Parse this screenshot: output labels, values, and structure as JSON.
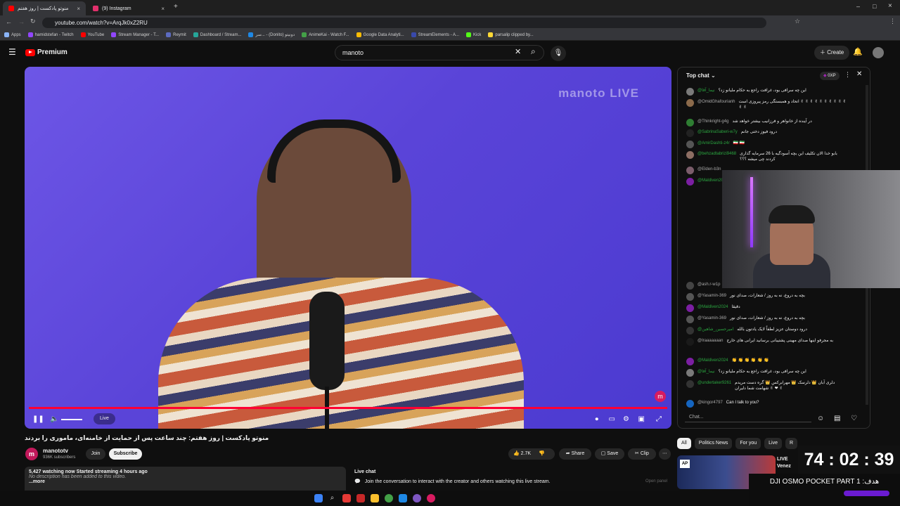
{
  "browser": {
    "tabs": [
      {
        "label": "منوتو پادکست | روز هفتم",
        "active": true
      },
      {
        "label": "(9) Instagram",
        "active": false
      }
    ],
    "url": "youtube.com/watch?v=ArqJk0xZ2RU",
    "bookmarks": [
      "Apps",
      "hamidstefan - Twitch",
      "YouTube",
      "Stream Manager - T...",
      "Reymit",
      "Dashboard / Stream...",
      "سر... - (Donito) دونیتو",
      "AnimeKai - Watch F...",
      "Google Data Analyti...",
      "StreamElements - A...",
      "Kick",
      "parsalip clipped by..."
    ]
  },
  "youtube": {
    "brand": "Premium",
    "search_value": "manoto",
    "create_label": "Create"
  },
  "video": {
    "watermark": "manoto LIVE",
    "live_label": "Live",
    "title": "منوتو پادکست | روز هفتم: چند ساعت پس از حمایت از خامنه‌ای، ماموری را بردند",
    "channel": "manototv",
    "subscribers": "936K subscribers",
    "join_label": "Join",
    "subscribe_label": "Subscribe",
    "likes": "2.7K",
    "share_label": "Share",
    "save_label": "Save",
    "clip_label": "Clip",
    "watching": "5,427 watching now  Started streaming 4 hours ago",
    "description": "No description has been added to this video.",
    "more_label": "...more",
    "livechat_title": "Live chat",
    "livechat_note": "Join the conversation to interact with the creator and others watching this live stream.",
    "open_panel_label": "Open panel"
  },
  "chat": {
    "mode": "Top chat",
    "points": "0XP",
    "input_placeholder": "Chat...",
    "messages": [
      {
        "author": "@نیما_آقا",
        "text": "این چه سرافی بود، غرافت راجع به حکام ملیانو زد؟",
        "color": "#7a7a7a"
      },
      {
        "author": "@OmidGhafourianh",
        "text": "اتحاد و همبستگی رمز پیروزی است ✌ ✌ ✌ ✌ ✌ ✌ ✌ ✌ ✌ ✌ ✌ ✌",
        "color": "#8b6a4b"
      },
      {
        "author": "@Thinkright-g4g",
        "text": "در آینده از خانواهر و فرزانیب بیشتر خواهد شد",
        "color": "#2e7d32"
      },
      {
        "author": "@SabrinaSaberi-w7y",
        "text": "درود فیوز دختی جانم",
        "color": "#222222"
      },
      {
        "author": "@AmirDashti-z4r",
        "text": "🇮🇷 🇮🇷",
        "color": "#555555"
      },
      {
        "author": "@behzadtabrizi9468",
        "text": "بابو خدا الان تکلیف این بچه آسودگیه با 26 سرمایه گذاری کردند چی میشه ؟؟؟",
        "color": "#8d6e63"
      },
      {
        "author": "@Elden-b3n",
        "text": "",
        "color": "#7b5d6b"
      },
      {
        "author": "@Maldiven2024",
        "text": "",
        "color": "#7b1fa2"
      },
      {
        "author": "@ash.r-w1p",
        "text": "",
        "color": "#444444"
      },
      {
        "author": "@Yasamin-369",
        "text": "بچه به دروغ، نه به روز / شعارات، صدای نور",
        "color": "#555555"
      },
      {
        "author": "@Maldiven2024",
        "text": "دقیقا",
        "color": "#7b1fa2"
      },
      {
        "author": "@Yasamin-369",
        "text": "بچه به دروغ، نه به روز / شعارات، صدای نور",
        "color": "#555555"
      },
      {
        "author": "@امیرحسین_شاهین",
        "text": "درود دوستان عزیز لطفاً لایک یادتون بالله",
        "color": "#333333"
      },
      {
        "author": "@Iraaaaaaan",
        "text": "به مجرفو اینها صدای مهبنی پشتیبانی برسانید ایرانی های خارج",
        "color": "#1a1a1a"
      },
      {
        "author": "@Maldiven2024",
        "text": "👏 👏 👏 👏 👏 👏",
        "color": "#7b1fa2"
      },
      {
        "author": "@نیما_آقا",
        "text": "این چه سرافی بود، غرافت راجع به حکام ملیانو زد؟",
        "color": "#7a7a7a"
      },
      {
        "author": "@undertaker9261",
        "text": "دلری آبان 👑 دلرسک 👑 مهرابرکس 👑 گره دست مریدم شهامت شما دلیران ✌ ❤ ✌",
        "color": "#333333"
      },
      {
        "author": "@kingor4797",
        "text": "Can I talk to you?",
        "color": "#1565c0"
      }
    ]
  },
  "recs": {
    "chips": [
      "All",
      "Politics News",
      "For you",
      "Live",
      "R"
    ],
    "badge_text": "LIVE",
    "channel_text": "Venez"
  },
  "overlay": {
    "timer": "74 : 02 : 39",
    "goal": "DJI OSMO POCKET PART 1 :هدف"
  }
}
